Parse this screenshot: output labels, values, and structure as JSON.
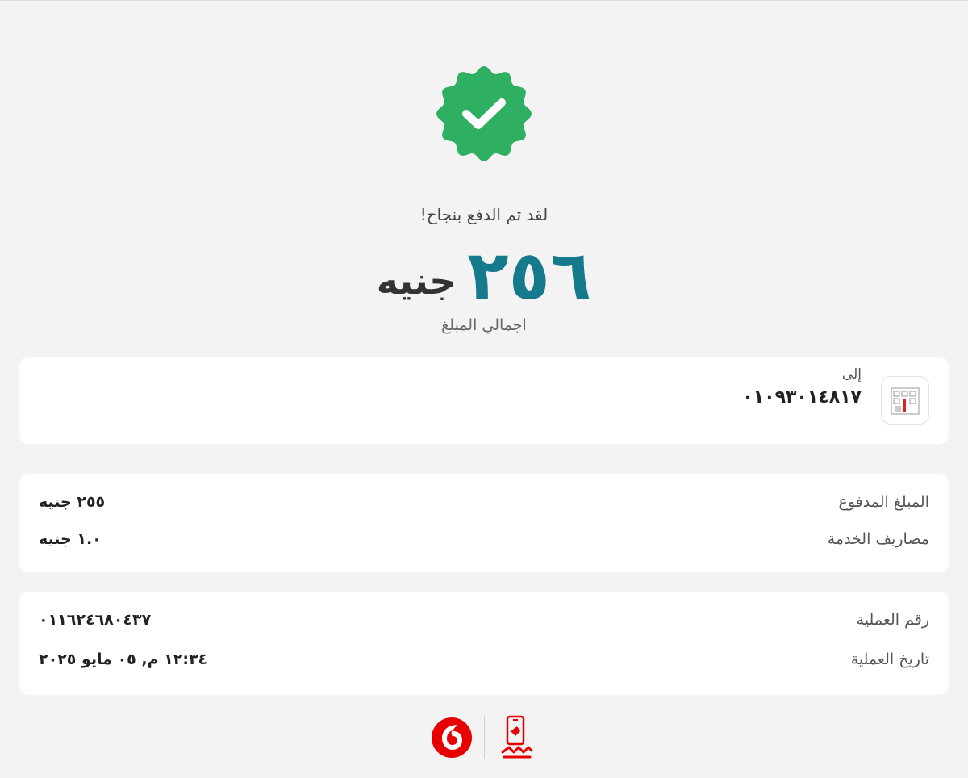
{
  "success": {
    "message": "لقد تم الدفع بنجاح!",
    "icon": "check-badge-icon",
    "accent_color": "#2eaf62"
  },
  "total": {
    "amount": "٢٥٦",
    "currency": "جنيه",
    "label": "اجمالي المبلغ",
    "amount_color": "#157a8b"
  },
  "recipient": {
    "label": "إلى",
    "number": "٠١٠٩٣٠١٤٨١٧"
  },
  "amounts": [
    {
      "label": "المبلغ المدفوع",
      "value": "٢٥٥ جنيه"
    },
    {
      "label": "مصاريف الخدمة",
      "value": "١.٠ جنيه"
    }
  ],
  "transaction": [
    {
      "label": "رقم العملية",
      "value": "٠١١٦٢٤٦٨٠٤٣٧"
    },
    {
      "label": "تاريخ العملية",
      "value": "١٢:٣٤ م, ٠٥ مايو ٢٠٢٥"
    }
  ],
  "footer": {
    "vodafone_color": "#e60000",
    "cash_color": "#e60000"
  }
}
